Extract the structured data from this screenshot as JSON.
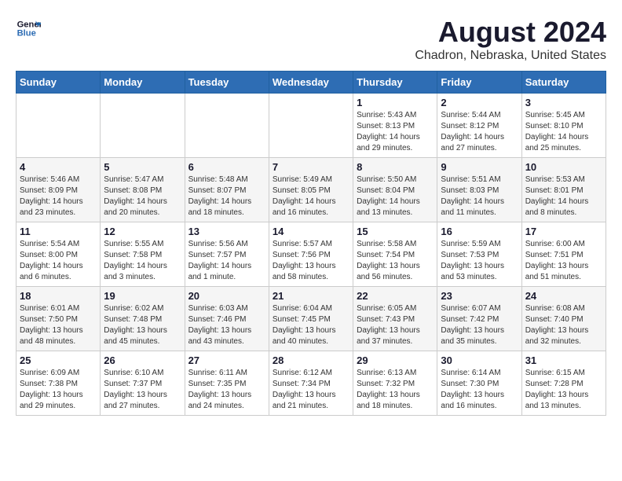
{
  "header": {
    "logo_line1": "General",
    "logo_line2": "Blue",
    "month_year": "August 2024",
    "location": "Chadron, Nebraska, United States"
  },
  "weekdays": [
    "Sunday",
    "Monday",
    "Tuesday",
    "Wednesday",
    "Thursday",
    "Friday",
    "Saturday"
  ],
  "weeks": [
    [
      {
        "day": "",
        "info": ""
      },
      {
        "day": "",
        "info": ""
      },
      {
        "day": "",
        "info": ""
      },
      {
        "day": "",
        "info": ""
      },
      {
        "day": "1",
        "info": "Sunrise: 5:43 AM\nSunset: 8:13 PM\nDaylight: 14 hours\nand 29 minutes."
      },
      {
        "day": "2",
        "info": "Sunrise: 5:44 AM\nSunset: 8:12 PM\nDaylight: 14 hours\nand 27 minutes."
      },
      {
        "day": "3",
        "info": "Sunrise: 5:45 AM\nSunset: 8:10 PM\nDaylight: 14 hours\nand 25 minutes."
      }
    ],
    [
      {
        "day": "4",
        "info": "Sunrise: 5:46 AM\nSunset: 8:09 PM\nDaylight: 14 hours\nand 23 minutes."
      },
      {
        "day": "5",
        "info": "Sunrise: 5:47 AM\nSunset: 8:08 PM\nDaylight: 14 hours\nand 20 minutes."
      },
      {
        "day": "6",
        "info": "Sunrise: 5:48 AM\nSunset: 8:07 PM\nDaylight: 14 hours\nand 18 minutes."
      },
      {
        "day": "7",
        "info": "Sunrise: 5:49 AM\nSunset: 8:05 PM\nDaylight: 14 hours\nand 16 minutes."
      },
      {
        "day": "8",
        "info": "Sunrise: 5:50 AM\nSunset: 8:04 PM\nDaylight: 14 hours\nand 13 minutes."
      },
      {
        "day": "9",
        "info": "Sunrise: 5:51 AM\nSunset: 8:03 PM\nDaylight: 14 hours\nand 11 minutes."
      },
      {
        "day": "10",
        "info": "Sunrise: 5:53 AM\nSunset: 8:01 PM\nDaylight: 14 hours\nand 8 minutes."
      }
    ],
    [
      {
        "day": "11",
        "info": "Sunrise: 5:54 AM\nSunset: 8:00 PM\nDaylight: 14 hours\nand 6 minutes."
      },
      {
        "day": "12",
        "info": "Sunrise: 5:55 AM\nSunset: 7:58 PM\nDaylight: 14 hours\nand 3 minutes."
      },
      {
        "day": "13",
        "info": "Sunrise: 5:56 AM\nSunset: 7:57 PM\nDaylight: 14 hours\nand 1 minute."
      },
      {
        "day": "14",
        "info": "Sunrise: 5:57 AM\nSunset: 7:56 PM\nDaylight: 13 hours\nand 58 minutes."
      },
      {
        "day": "15",
        "info": "Sunrise: 5:58 AM\nSunset: 7:54 PM\nDaylight: 13 hours\nand 56 minutes."
      },
      {
        "day": "16",
        "info": "Sunrise: 5:59 AM\nSunset: 7:53 PM\nDaylight: 13 hours\nand 53 minutes."
      },
      {
        "day": "17",
        "info": "Sunrise: 6:00 AM\nSunset: 7:51 PM\nDaylight: 13 hours\nand 51 minutes."
      }
    ],
    [
      {
        "day": "18",
        "info": "Sunrise: 6:01 AM\nSunset: 7:50 PM\nDaylight: 13 hours\nand 48 minutes."
      },
      {
        "day": "19",
        "info": "Sunrise: 6:02 AM\nSunset: 7:48 PM\nDaylight: 13 hours\nand 45 minutes."
      },
      {
        "day": "20",
        "info": "Sunrise: 6:03 AM\nSunset: 7:46 PM\nDaylight: 13 hours\nand 43 minutes."
      },
      {
        "day": "21",
        "info": "Sunrise: 6:04 AM\nSunset: 7:45 PM\nDaylight: 13 hours\nand 40 minutes."
      },
      {
        "day": "22",
        "info": "Sunrise: 6:05 AM\nSunset: 7:43 PM\nDaylight: 13 hours\nand 37 minutes."
      },
      {
        "day": "23",
        "info": "Sunrise: 6:07 AM\nSunset: 7:42 PM\nDaylight: 13 hours\nand 35 minutes."
      },
      {
        "day": "24",
        "info": "Sunrise: 6:08 AM\nSunset: 7:40 PM\nDaylight: 13 hours\nand 32 minutes."
      }
    ],
    [
      {
        "day": "25",
        "info": "Sunrise: 6:09 AM\nSunset: 7:38 PM\nDaylight: 13 hours\nand 29 minutes."
      },
      {
        "day": "26",
        "info": "Sunrise: 6:10 AM\nSunset: 7:37 PM\nDaylight: 13 hours\nand 27 minutes."
      },
      {
        "day": "27",
        "info": "Sunrise: 6:11 AM\nSunset: 7:35 PM\nDaylight: 13 hours\nand 24 minutes."
      },
      {
        "day": "28",
        "info": "Sunrise: 6:12 AM\nSunset: 7:34 PM\nDaylight: 13 hours\nand 21 minutes."
      },
      {
        "day": "29",
        "info": "Sunrise: 6:13 AM\nSunset: 7:32 PM\nDaylight: 13 hours\nand 18 minutes."
      },
      {
        "day": "30",
        "info": "Sunrise: 6:14 AM\nSunset: 7:30 PM\nDaylight: 13 hours\nand 16 minutes."
      },
      {
        "day": "31",
        "info": "Sunrise: 6:15 AM\nSunset: 7:28 PM\nDaylight: 13 hours\nand 13 minutes."
      }
    ]
  ]
}
